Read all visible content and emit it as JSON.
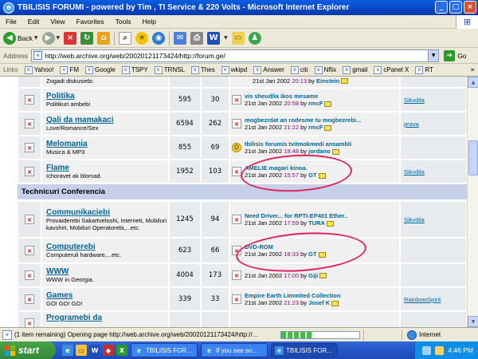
{
  "window": {
    "title": "TBILISIS FORUMI - powered by Tim , TI Service & 220 Volts - Microsoft Internet Explorer",
    "buttons": [
      "_",
      "□",
      "×"
    ]
  },
  "menu": [
    "File",
    "Edit",
    "View",
    "Favorites",
    "Tools",
    "Help"
  ],
  "toolbar": {
    "back_label": "Back",
    "icons": [
      "forward-icon",
      "stop-icon",
      "refresh-icon",
      "home-icon",
      "search-icon",
      "favorites-icon",
      "media-icon",
      "mail-icon",
      "print-icon",
      "word-icon",
      "discuss-icon",
      "messenger-icon"
    ]
  },
  "address": {
    "label": "Address",
    "url": "http://web.archive.org/web/20020121173424/http://forum.ge/",
    "go_label": "Go"
  },
  "links": {
    "label": "Links",
    "items": [
      "Yahoo!",
      "FM",
      "Google",
      "TSPY",
      "TRNSL",
      "Thes",
      "wkipd",
      "Answer",
      "citi",
      "Nflix",
      "gmail",
      "cPanel X",
      "RT"
    ]
  },
  "forums": [
    {
      "name": "",
      "desc": "Zogadi diskusiebi.",
      "topics": "",
      "posts": "",
      "last_title": "",
      "last_date": "21st Jan 2002",
      "last_time": "20:13",
      "last_author": "Einstein",
      "mod": ""
    },
    {
      "name": "Politika",
      "desc": "Politikuri ambebi",
      "topics": "595",
      "posts": "30",
      "last_title": "vis sheudlia ikos mesame",
      "last_date": "21st Jan 2002",
      "last_time": "20:58",
      "last_author": "rmcF",
      "mod": "Sikvdila"
    },
    {
      "name": "Qali da mamakaci",
      "desc": "Love/Romance/Sex",
      "topics": "6594",
      "posts": "262",
      "last_title": "mogbezrdat an rodesme tu mogbezrebi...",
      "last_date": "21st Jan 2002",
      "last_time": "21:22",
      "last_author": "rmcF",
      "mod": "prava"
    },
    {
      "name": "Melomania",
      "desc": "Musica & MP3",
      "topics": "855",
      "posts": "69",
      "last_title": "tbilisis forumis tvitmokmedi ansambli",
      "last_date": "21st Jan 2002",
      "last_time": "19:48",
      "last_author": "jordano",
      "mod": ""
    },
    {
      "name": "Flame",
      "desc": "Ichoravet ak blomad.",
      "topics": "1952",
      "posts": "103",
      "last_title": "AMELIE magari kinoa.",
      "last_date": "21st Jan 2002",
      "last_time": "15:57",
      "last_author": "GT",
      "mod": "Sikvdila"
    }
  ],
  "category": "Technicuri Conferencia",
  "tech_forums": [
    {
      "name": "Communikaciebi",
      "desc": "Provaiderebi Sakartveloshi, Interneti, Mobiluri kavshiri, Mobiluri Operatorebi,...etc.",
      "topics": "1245",
      "posts": "94",
      "last_title": "Need Driver... for RPTI-EP401 Ether..",
      "last_date": "21st Jan 2002",
      "last_time": "17:59",
      "last_author": "TURA",
      "mod": "Sikvdila"
    },
    {
      "name": "Computerebi",
      "desc": "Computeruli hardware,...etc.",
      "topics": "623",
      "posts": "66",
      "last_title": "DVD-ROM",
      "last_date": "21st Jan 2002",
      "last_time": "18:33",
      "last_author": "GT",
      "mod": ""
    },
    {
      "name": "WWW",
      "desc": "WWW in Georgia.",
      "topics": "4004",
      "posts": "173",
      "last_title": "",
      "last_date": "21st Jan 2002",
      "last_time": "17:00",
      "last_author": "Giji",
      "mod": ""
    },
    {
      "name": "Games",
      "desc": "GO! GO! GO!",
      "topics": "339",
      "posts": "33",
      "last_title": "Empire Earth Limmited Collection",
      "last_date": "21st Jan 2002",
      "last_time": "21:23",
      "last_author": "Josef K",
      "mod": "RainbowSpirit"
    },
    {
      "name": "Programebi da",
      "desc": "",
      "topics": "",
      "posts": "",
      "last_title": "",
      "last_date": "",
      "last_time": "",
      "last_author": "",
      "mod": ""
    }
  ],
  "by_label": "by",
  "status": {
    "text": "(1 item remaining) Opening page http://web.archive.org/web/20020121173424/http://...",
    "zone": "Internet"
  },
  "taskbar": {
    "start": "start",
    "tasks": [
      "TBILISIS FOR...",
      "If you see so...",
      "TBILISIS FOR..."
    ],
    "clock": "4:46 PM"
  },
  "colors": {
    "link": "#006699",
    "time": "#990099",
    "category_bg": "#c7d0ea",
    "annotation_circle": "#e0245a"
  }
}
